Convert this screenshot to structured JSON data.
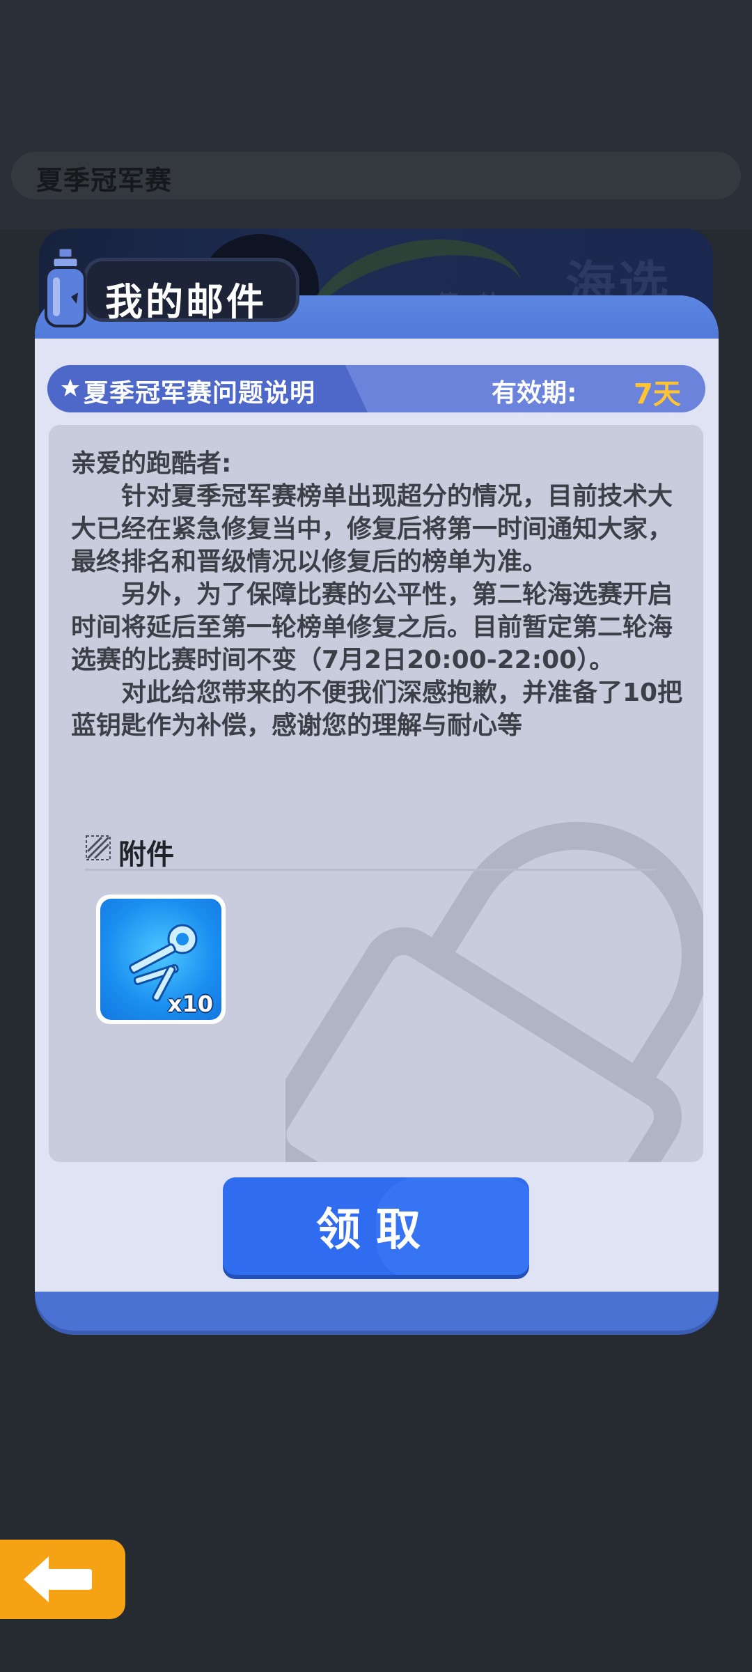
{
  "event": {
    "title": "夏季冠军赛"
  },
  "banner": {
    "round_label": "第一轮",
    "big_label": "海选赛"
  },
  "modal": {
    "title": "我的邮件"
  },
  "mail": {
    "subject": "夏季冠军赛问题说明",
    "expiry_label": "有效期:",
    "expiry_value": "7天",
    "greeting": "亲爱的跑酷者:",
    "paragraphs": [
      "针对夏季冠军赛榜单出现超分的情况，目前技术大大已经在紧急修复当中，修复后将第一时间通知大家，最终排名和晋级情况以修复后的榜单为准。",
      "另外，为了保障比赛的公平性，第二轮海选赛开启时间将延后至第一轮榜单修复之后。目前暂定第二轮海选赛的比赛时间不变（7月2日20:00-22:00）。",
      "对此给您带来的不便我们深感抱歉，并准备了10把蓝钥匙作为补偿，感谢您的理解与耐心等"
    ]
  },
  "attachments": {
    "label": "附件",
    "items": [
      {
        "name": "blue-key",
        "count": "x10"
      }
    ]
  },
  "actions": {
    "claim_label": "领取"
  },
  "colors": {
    "accent": "#2f6cf0",
    "expiry": "#ffc531",
    "back": "#f5a314"
  }
}
